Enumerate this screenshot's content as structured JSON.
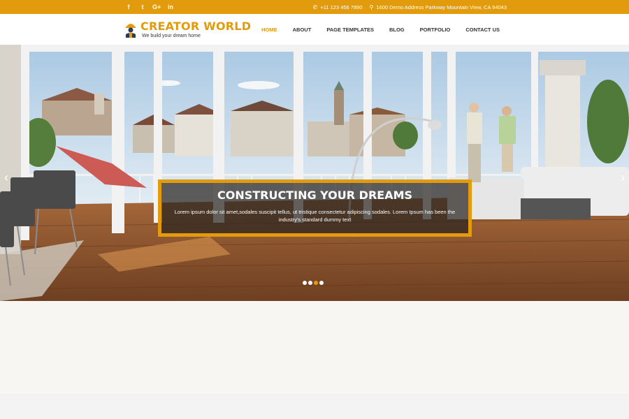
{
  "topbar": {
    "social": [
      {
        "name": "facebook-icon",
        "glyph": "f"
      },
      {
        "name": "twitter-icon",
        "glyph": "t"
      },
      {
        "name": "google-plus-icon",
        "glyph": "G+"
      },
      {
        "name": "linkedin-icon",
        "glyph": "in"
      }
    ],
    "phone": "+11 123 456 7890",
    "address": "1600 Demo Address Parkway Mountain View, CA 94043"
  },
  "header": {
    "logo_title": "CREATOR WORLD",
    "logo_subtitle": "We build your dream home",
    "nav": [
      {
        "label": "HOME",
        "active": true
      },
      {
        "label": "ABOUT",
        "active": false
      },
      {
        "label": "PAGE TEMPLATES",
        "active": false
      },
      {
        "label": "BLOG",
        "active": false
      },
      {
        "label": "PORTFOLIO",
        "active": false
      },
      {
        "label": "CONTACT US",
        "active": false
      }
    ]
  },
  "slider": {
    "caption_title": "CONSTRUCTING YOUR DREAMS",
    "caption_text": "Lorem ipsum dolor sit amet,sodales suscipit tellus, ut tristique consectetur adipiscing sodales. Lorem Ipsum has been the industry's standard dummy text",
    "dots": 4,
    "active_dot": 2,
    "prev_glyph": "‹",
    "next_glyph": "›"
  },
  "colors": {
    "accent": "#e39b0e",
    "topbar": "#e39b0e",
    "nav_text": "#333333"
  }
}
